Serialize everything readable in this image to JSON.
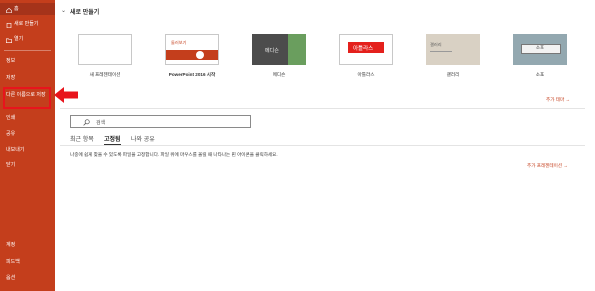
{
  "sidebar": {
    "items": [
      {
        "label": "홈",
        "icon": "home-icon"
      },
      {
        "label": "새로 만들기",
        "icon": "new-document-icon"
      },
      {
        "label": "열기",
        "icon": "folder-open-icon"
      },
      {
        "label": "정보"
      },
      {
        "label": "저장"
      },
      {
        "label": "다른 이름으로 저장"
      },
      {
        "label": "인쇄"
      },
      {
        "label": "공유"
      },
      {
        "label": "내보내기"
      },
      {
        "label": "닫기"
      }
    ],
    "bottom_items": [
      {
        "label": "계정"
      },
      {
        "label": "피드백"
      },
      {
        "label": "옵션"
      }
    ]
  },
  "main": {
    "section_title": "새로 만들기",
    "templates": [
      {
        "label": "새 프레젠테이션",
        "thumb_text": ""
      },
      {
        "label": "PowerPoint 2016 시작",
        "thumb_text": "둘러보기"
      },
      {
        "label": "메디슨",
        "thumb_text": "메디슨"
      },
      {
        "label": "아틀라스",
        "thumb_text": "아틀라스"
      },
      {
        "label": "갤러리",
        "thumb_text": "갤러리"
      },
      {
        "label": "소포",
        "thumb_text": "소포"
      }
    ],
    "more_themes": "추가 테마 →",
    "search_placeholder": "검색",
    "tabs": [
      "최근 항목",
      "고정됨",
      "나와 공유"
    ],
    "active_tab": "고정됨",
    "pinned_description": "나중에 쉽게 찾을 수 있도록 파일을 고정합니다. 파일 위에 마우스를 올릴 때 나타나는 핀 아이콘을 클릭하세요.",
    "more_presentations": "추가 프레젠테이션 →"
  },
  "colors": {
    "sidebar": "#c43e1c",
    "annotation": "#e8141c",
    "accent": "#c43e1c"
  }
}
